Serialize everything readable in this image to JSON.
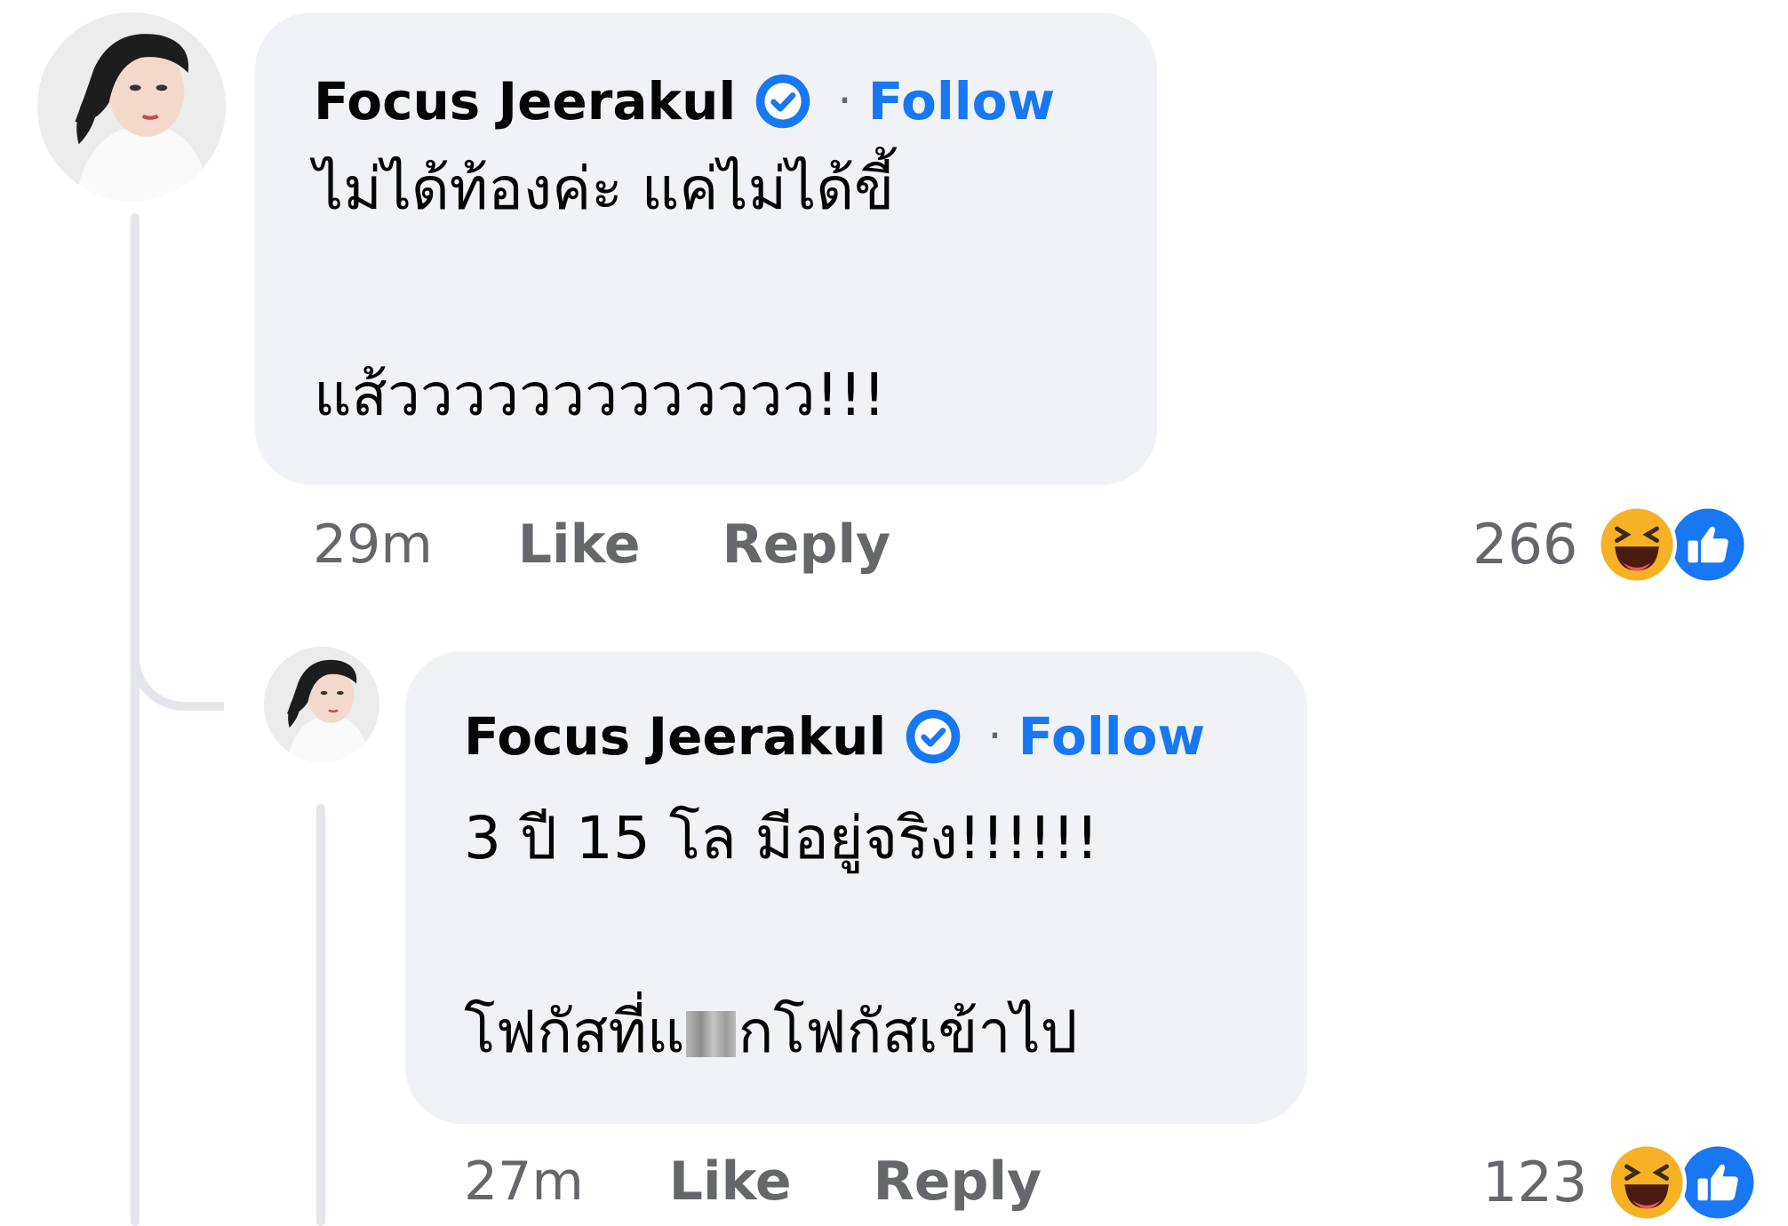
{
  "comments": [
    {
      "author": "Focus Jeerakul",
      "separator": "·",
      "follow_label": "Follow",
      "text_line1": "ไม่ได้ท้องค่ะ แค่ไม่ได้ขี้",
      "text_line2": "แส้ววววววววววววว!!!",
      "time": "29m",
      "like_label": "Like",
      "reply_label": "Reply",
      "reaction_count": "266",
      "reactions": [
        "haha-icon",
        "like-icon"
      ]
    },
    {
      "author": "Focus Jeerakul",
      "separator": "·",
      "follow_label": "Follow",
      "text_line1": "3 ปี 15 โล มีอยู่จริง!!!!!!",
      "text_line2_before": "โฟกัสที่แ",
      "text_line2_after": "กโฟกัสเข้าไป",
      "time": "27m",
      "like_label": "Like",
      "reply_label": "Reply",
      "reaction_count": "123",
      "reactions": [
        "haha-icon",
        "like-icon"
      ]
    }
  ],
  "colors": {
    "bubble_bg": "#f0f2f5",
    "link_blue": "#1877f2",
    "meta_gray": "#65676b",
    "thread_line": "#e4e6eb"
  }
}
